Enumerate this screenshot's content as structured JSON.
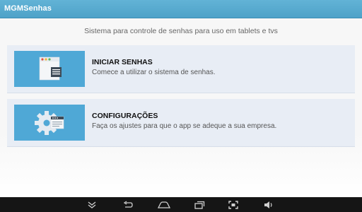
{
  "app_bar": {
    "title": "MGMSenhas",
    "color": "#58abd0"
  },
  "main": {
    "subtitle": "Sistema para controle de senhas para uso em tablets e tvs",
    "cards": [
      {
        "icon": "browser-window-icon",
        "title": "INICIAR SENHAS",
        "description": "Comece a utilizar o sistema de senhas."
      },
      {
        "icon": "gear-window-icon",
        "title": "CONFIGURAÇÕES",
        "description": "Faça os ajustes para que o app se adeque a sua empresa."
      }
    ]
  },
  "nav_bar": {
    "buttons": [
      "collapse-icon",
      "back-icon",
      "home-icon",
      "recent-apps-icon",
      "screenshot-icon",
      "volume-icon"
    ]
  },
  "colors": {
    "accent": "#4fa8d6",
    "card_background": "#e8edf5",
    "nav_background": "#151515"
  }
}
